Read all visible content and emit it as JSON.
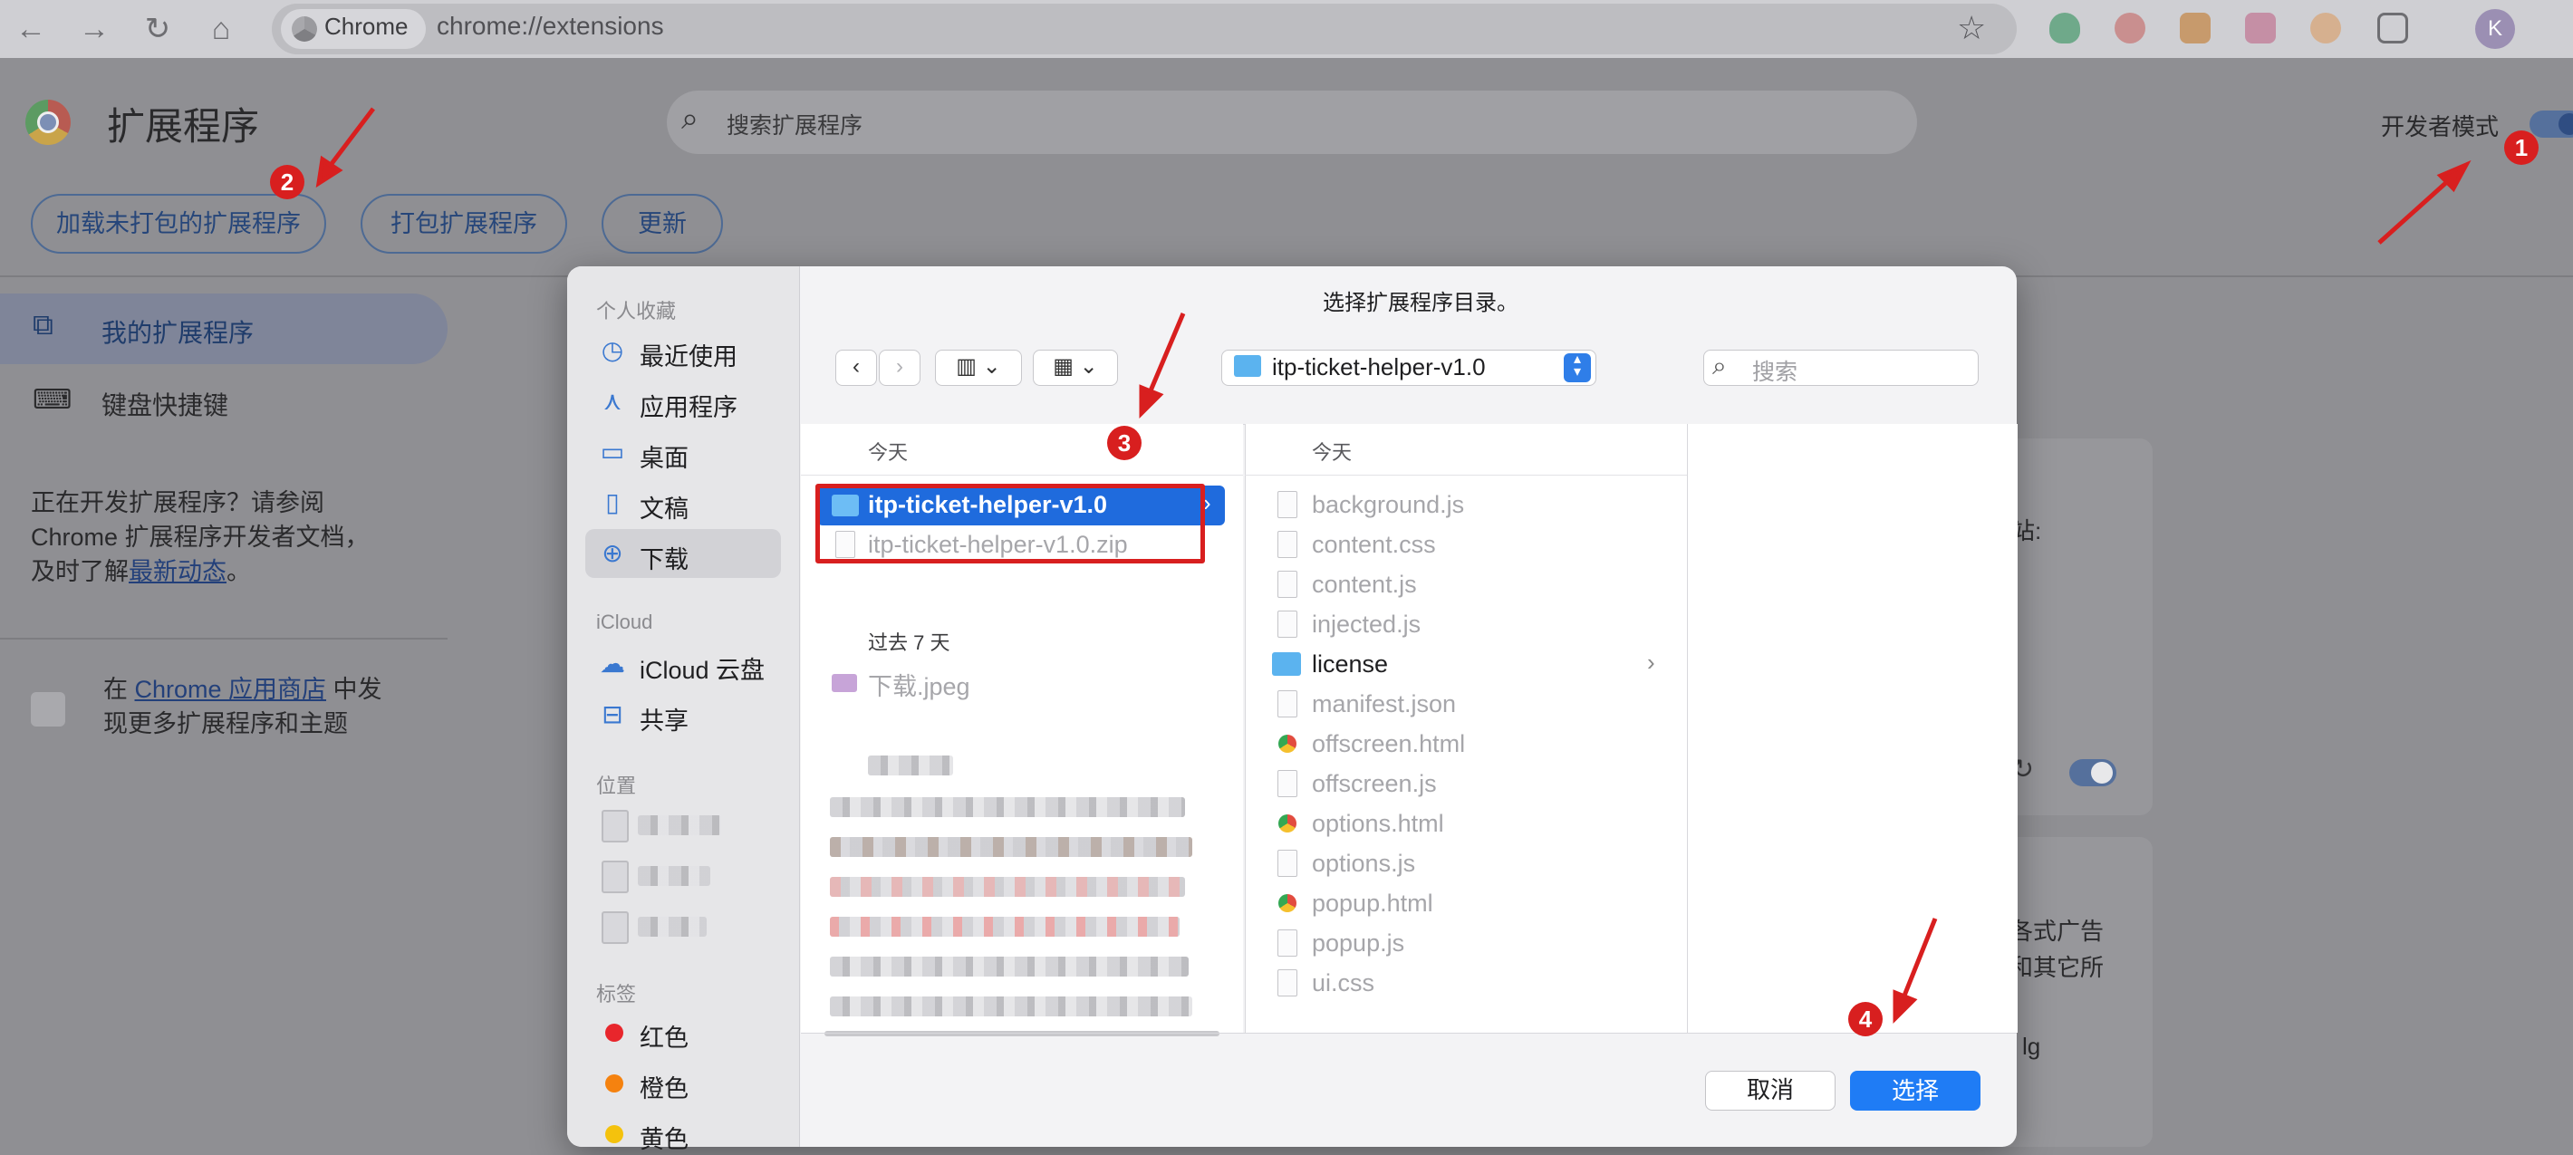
{
  "browser": {
    "chip_label": "Chrome",
    "url": "chrome://extensions",
    "avatar_letter": "K"
  },
  "page": {
    "title": "扩展程序",
    "search_placeholder": "搜索扩展程序",
    "dev_mode_label": "开发者模式",
    "dev_mode_on": true,
    "buttons": {
      "load_unpacked": "加载未打包的扩展程序",
      "pack": "打包扩展程序",
      "update": "更新"
    },
    "nav": {
      "my_extensions": "我的扩展程序",
      "keyboard_shortcuts": "键盘快捷键"
    },
    "dev_text": {
      "line1": "正在开发扩展程序？请参阅",
      "line2": "Chrome 扩展程序开发者文档，",
      "line3_prefix": "及时了解",
      "line3_link": "最新动态",
      "line3_suffix": "。"
    },
    "store_text": {
      "prefix": "在 ",
      "link": "Chrome 应用商店",
      "suffix": " 中发",
      "line2": "现更多扩展程序和主题"
    },
    "card1_text": "站:",
    "card2_lines": [
      "各式广告",
      "和其它所",
      "lg"
    ]
  },
  "dialog": {
    "title": "选择扩展程序目录。",
    "path_label": "itp-ticket-helper-v1.0",
    "search_placeholder": "搜索",
    "sidebar": {
      "favorites_heading": "个人收藏",
      "favorites": [
        {
          "label": "最近使用",
          "icon": "clock-icon"
        },
        {
          "label": "应用程序",
          "icon": "apps-icon"
        },
        {
          "label": "桌面",
          "icon": "desktop-icon"
        },
        {
          "label": "文稿",
          "icon": "document-icon"
        },
        {
          "label": "下载",
          "icon": "download-icon",
          "selected": true
        }
      ],
      "icloud_heading": "iCloud",
      "icloud": [
        {
          "label": "iCloud 云盘",
          "icon": "cloud-icon"
        },
        {
          "label": "共享",
          "icon": "shared-folder-icon"
        }
      ],
      "locations_heading": "位置",
      "tags_heading": "标签",
      "tags": [
        {
          "label": "红色",
          "color": "#e8262c"
        },
        {
          "label": "橙色",
          "color": "#f5820f"
        },
        {
          "label": "黄色",
          "color": "#f4c20d"
        }
      ]
    },
    "col1": {
      "today_heading": "今天",
      "today_items": [
        {
          "name": "itp-ticket-helper-v1.0",
          "type": "folder",
          "selected": true
        },
        {
          "name": "itp-ticket-helper-v1.0.zip",
          "type": "zip"
        }
      ],
      "past7_heading": "过去 7 天",
      "past7_items": [
        {
          "name": "下载.jpeg",
          "type": "image"
        }
      ]
    },
    "col2": {
      "today_heading": "今天",
      "files": [
        {
          "name": "background.js",
          "type": "file"
        },
        {
          "name": "content.css",
          "type": "file"
        },
        {
          "name": "content.js",
          "type": "file"
        },
        {
          "name": "injected.js",
          "type": "file"
        },
        {
          "name": "license",
          "type": "folder"
        },
        {
          "name": "manifest.json",
          "type": "file"
        },
        {
          "name": "offscreen.html",
          "type": "html"
        },
        {
          "name": "offscreen.js",
          "type": "file"
        },
        {
          "name": "options.html",
          "type": "html"
        },
        {
          "name": "options.js",
          "type": "file"
        },
        {
          "name": "popup.html",
          "type": "html"
        },
        {
          "name": "popup.js",
          "type": "file"
        },
        {
          "name": "ui.css",
          "type": "file"
        }
      ]
    },
    "cancel_label": "取消",
    "choose_label": "选择"
  },
  "annotations": {
    "markers": [
      "1",
      "2",
      "3",
      "4"
    ],
    "accent_color": "#d81f1f"
  }
}
